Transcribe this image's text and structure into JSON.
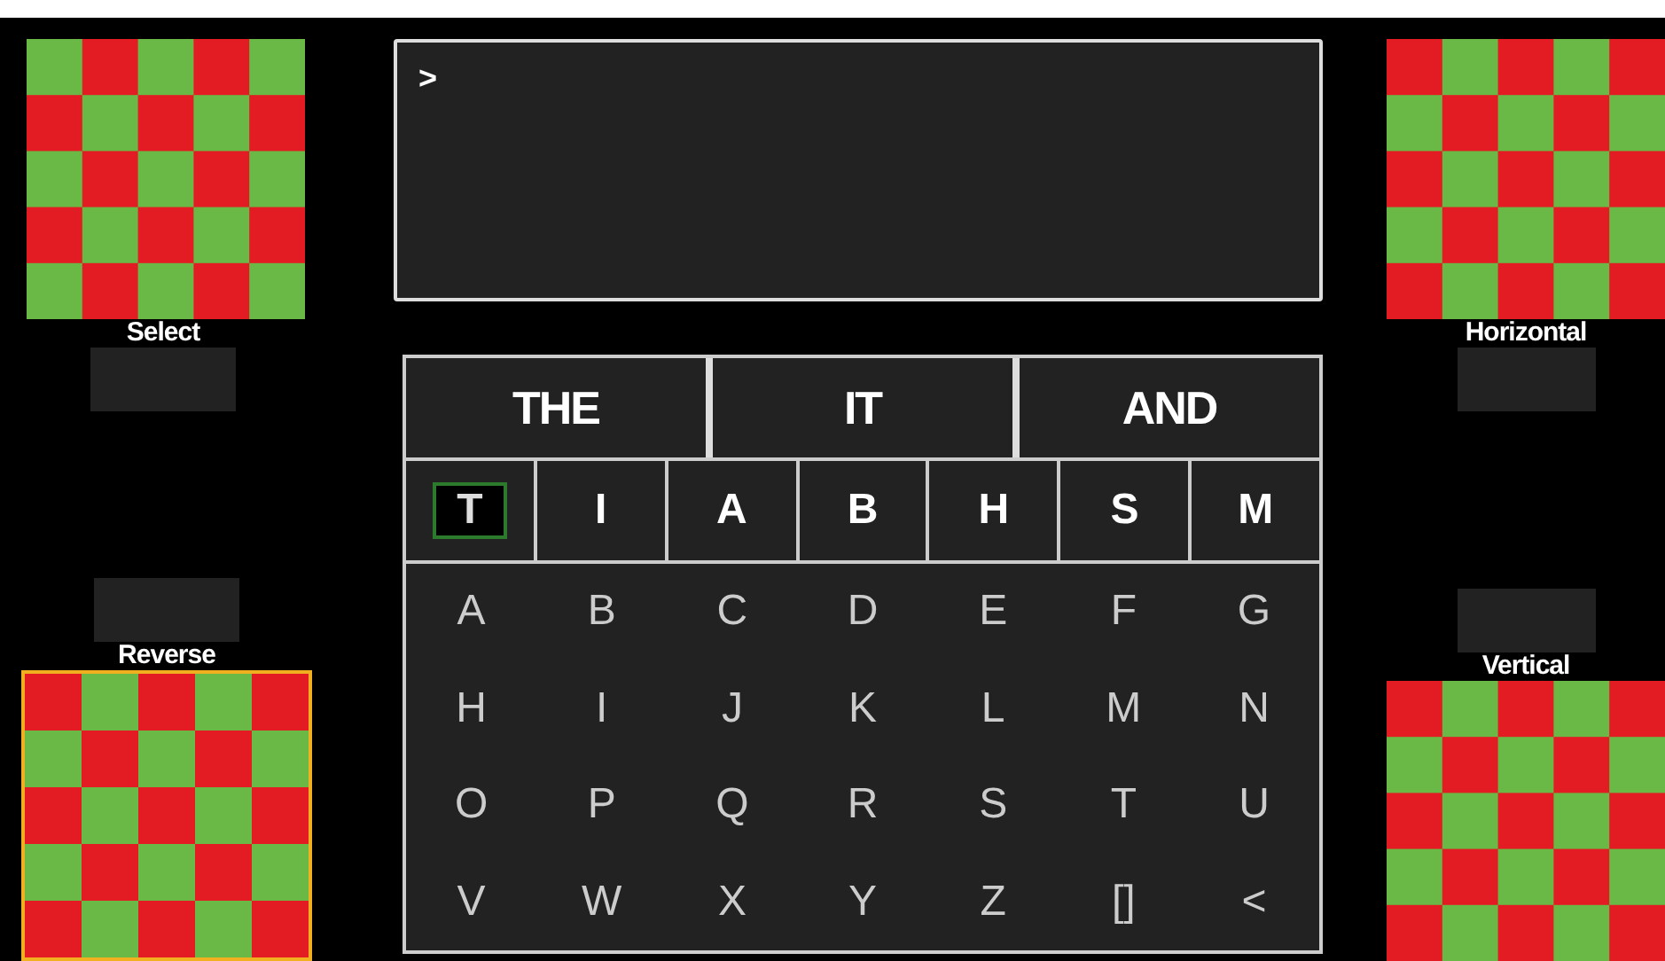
{
  "left_panels": [
    {
      "label": "Select",
      "selected": false
    },
    {
      "label": "Reverse",
      "selected": true
    }
  ],
  "right_panels": [
    {
      "label": "Horizontal",
      "selected": false
    },
    {
      "label": "Vertical",
      "selected": false
    }
  ],
  "output": {
    "prompt": ">"
  },
  "suggestions": [
    "THE",
    "IT",
    "AND"
  ],
  "quick_letters": [
    {
      "label": "T",
      "selected": true
    },
    {
      "label": "I",
      "selected": false
    },
    {
      "label": "A",
      "selected": false
    },
    {
      "label": "B",
      "selected": false
    },
    {
      "label": "H",
      "selected": false
    },
    {
      "label": "S",
      "selected": false
    },
    {
      "label": "M",
      "selected": false
    }
  ],
  "keys": [
    [
      "A",
      "B",
      "C",
      "D",
      "E",
      "F",
      "G"
    ],
    [
      "H",
      "I",
      "J",
      "K",
      "L",
      "M",
      "N"
    ],
    [
      "O",
      "P",
      "Q",
      "R",
      "S",
      "T",
      "U"
    ],
    [
      "V",
      "W",
      "X",
      "Y",
      "Z",
      "[]",
      "<"
    ]
  ]
}
